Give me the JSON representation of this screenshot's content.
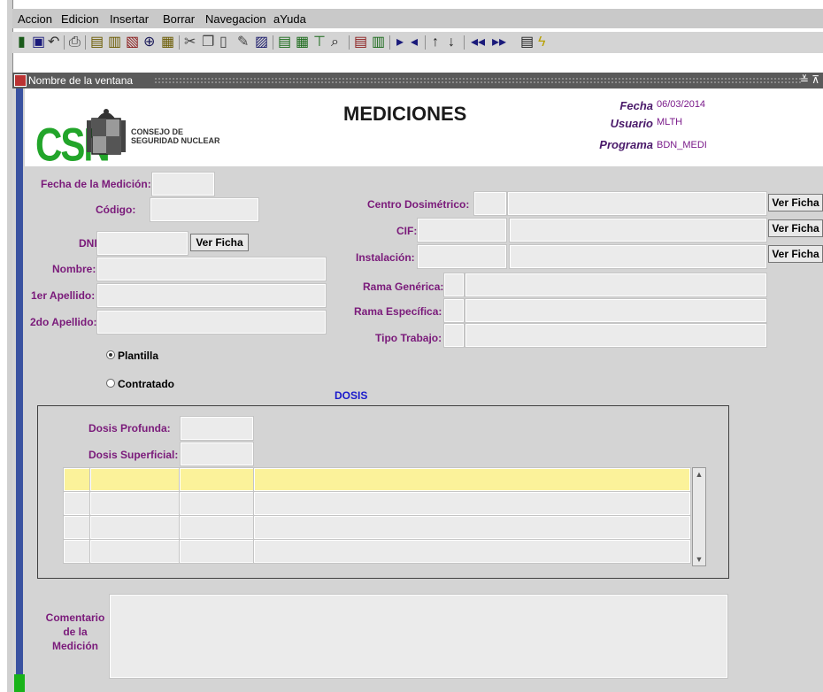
{
  "menu": [
    "Accion",
    "Edicion",
    "Insertar",
    "Borrar",
    "Navegacion",
    "aYuda"
  ],
  "window_title": "Nombre de la ventana",
  "window_controls": "≚ ⊼",
  "header": {
    "logo_text": "CSN",
    "logo_subtitle_1": "CONSEJO DE",
    "logo_subtitle_2": "SEGURIDAD NUCLEAR",
    "title": "MEDICIONES",
    "fecha_label": "Fecha",
    "fecha_value": "06/03/2014",
    "usuario_label": "Usuario",
    "usuario_value": "MLTH",
    "programa_label": "Programa",
    "programa_value": "BDN_MEDI"
  },
  "form": {
    "fecha_medicion": "Fecha de la Medición:",
    "codigo": "Código:",
    "dni": "DNI:",
    "ver_ficha": "Ver Ficha",
    "nombre": "Nombre:",
    "apellido1": "1er Apellido:",
    "apellido2": "2do Apellido:",
    "centro": "Centro Dosimétrico:",
    "cif": "CIF:",
    "instalacion": "Instalación:",
    "rama_generica": "Rama Genérica:",
    "rama_especifica": "Rama Específica:",
    "tipo_trabajo": "Tipo Trabajo:",
    "radio_plantilla": "Plantilla",
    "radio_contratado": "Contratado",
    "radio_selected": "Plantilla"
  },
  "dosis": {
    "section": "DOSIS",
    "profunda": "Dosis Profunda:",
    "superficial": "Dosis Superficial:"
  },
  "comentario": {
    "line1": "Comentario",
    "line2": "de la",
    "line3": "Medición"
  },
  "colors": {
    "label": "#7a1a7a",
    "highlight_row": "#fbf29a",
    "logo_green": "#22a52a",
    "dosis_title": "#1a1acc"
  }
}
